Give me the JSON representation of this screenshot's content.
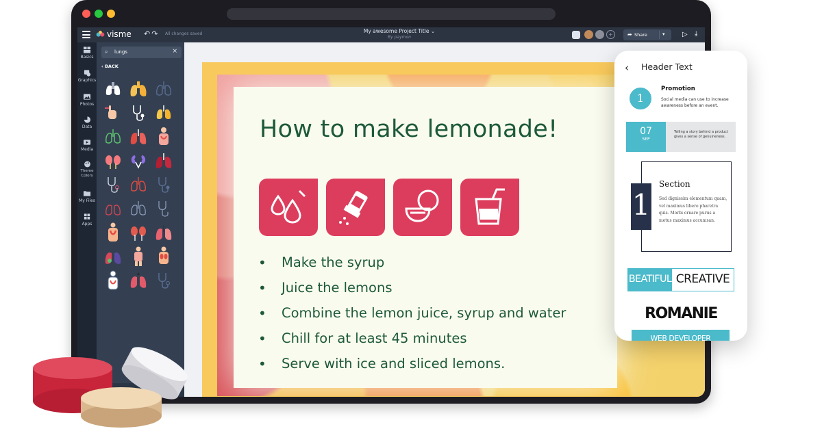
{
  "app": {
    "brand": "visme",
    "save_status": "All changes saved",
    "project_title": "My awesome Project Title",
    "project_author": "By paymon",
    "share_label": "Share"
  },
  "sidebar": {
    "items": [
      {
        "label": "Basics",
        "icon": "basics-icon"
      },
      {
        "label": "Graphics",
        "icon": "graphics-icon"
      },
      {
        "label": "Photos",
        "icon": "photos-icon"
      },
      {
        "label": "Data",
        "icon": "data-icon"
      },
      {
        "label": "Media",
        "icon": "media-icon"
      },
      {
        "label": "Theme Colors",
        "icon": "palette-icon"
      },
      {
        "label": "My Files",
        "icon": "folder-icon"
      },
      {
        "label": "Apps",
        "icon": "apps-icon"
      }
    ]
  },
  "graphics_panel": {
    "search_value": "lungs",
    "back_label": "BACK",
    "result_icons": [
      "lungs",
      "stethoscope",
      "organs",
      "kidneys",
      "anatomy"
    ]
  },
  "slide": {
    "title": "How to make lemonade!",
    "icons": [
      "drops-icon",
      "sugar-shaker-icon",
      "lemon-juicer-icon",
      "lemonade-glass-icon"
    ],
    "bullets": [
      "Make the syrup",
      "Juice the lemons",
      "Combine the lemon juice, syrup and water",
      "Chill for at least 45 minutes",
      "Serve with ice and sliced lemons."
    ],
    "bullet_glyph": "•"
  },
  "phone_preview": {
    "header": "Header Text",
    "promotion": {
      "number": "1",
      "title": "Promotion",
      "text": "Social media can use to increase awareness before an event."
    },
    "date": {
      "day": "07",
      "month": "SEP",
      "text": "Telling a story behind a product gives a sense of genuineness."
    },
    "section": {
      "number": "1",
      "title": "Section",
      "text": "Sed dignissim elementum quam, vel maximus libero pharetra quis. Morbi ornare purus a metus maximus accumsan."
    },
    "brand_a": "BEATIFUL",
    "brand_b": "CREATIVE",
    "brand_c": "ROMANIE",
    "brand_d": "WEB DEVELOPER"
  },
  "colors": {
    "accent_teal": "#4bbacb",
    "slide_green": "#1d5a3a",
    "icon_tile": "#dd3d5d",
    "app_dark": "#2c3442"
  }
}
